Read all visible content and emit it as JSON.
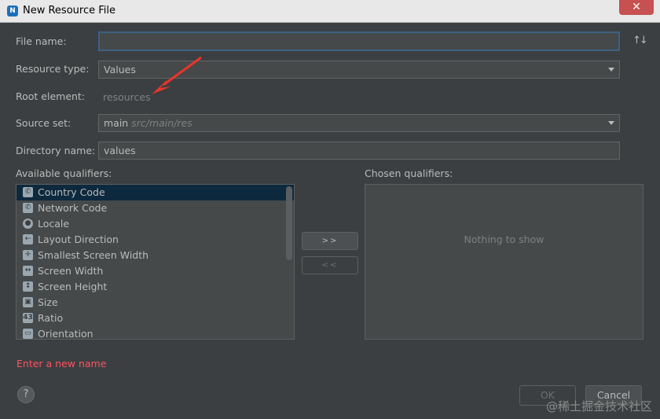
{
  "window": {
    "title": "New Resource File",
    "close_glyph": "✕",
    "app_icon": "N"
  },
  "form": {
    "file_name": {
      "label": "File name:",
      "value": ""
    },
    "resource_type": {
      "label": "Resource type:",
      "value": "Values"
    },
    "root_element": {
      "label": "Root element:",
      "value": "resources"
    },
    "source_set": {
      "label": "Source set:",
      "value": "main",
      "hint": "src/main/res"
    },
    "directory_name": {
      "label": "Directory name:",
      "value": "values"
    },
    "sort_glyph": "↑↓"
  },
  "qualifiers": {
    "available_label": "Available qualifiers:",
    "chosen_label": "Chosen qualifiers:",
    "chosen_empty": "Nothing to show",
    "items": [
      {
        "label": "Country Code",
        "icon": "country-code-icon",
        "selected": true
      },
      {
        "label": "Network Code",
        "icon": "network-code-icon",
        "selected": false
      },
      {
        "label": "Locale",
        "icon": "globe-icon",
        "selected": false
      },
      {
        "label": "Layout Direction",
        "icon": "layout-direction-icon",
        "selected": false
      },
      {
        "label": "Smallest Screen Width",
        "icon": "smallest-width-icon",
        "selected": false
      },
      {
        "label": "Screen Width",
        "icon": "screen-width-icon",
        "selected": false
      },
      {
        "label": "Screen Height",
        "icon": "screen-height-icon",
        "selected": false
      },
      {
        "label": "Size",
        "icon": "size-icon",
        "selected": false
      },
      {
        "label": "Ratio",
        "icon": "ratio-icon",
        "selected": false
      },
      {
        "label": "Orientation",
        "icon": "orientation-icon",
        "selected": false
      }
    ],
    "add_button": ">>",
    "remove_button": "<<"
  },
  "error_text": "Enter a new name",
  "footer": {
    "help": "?",
    "ok": "OK",
    "cancel": "Cancel"
  },
  "watermark": "@稀土掘金技术社区",
  "colors": {
    "background": "#3c3f41",
    "error": "#ff5261",
    "selection": "#0d293e",
    "annotation_arrow": "#e8352a"
  }
}
